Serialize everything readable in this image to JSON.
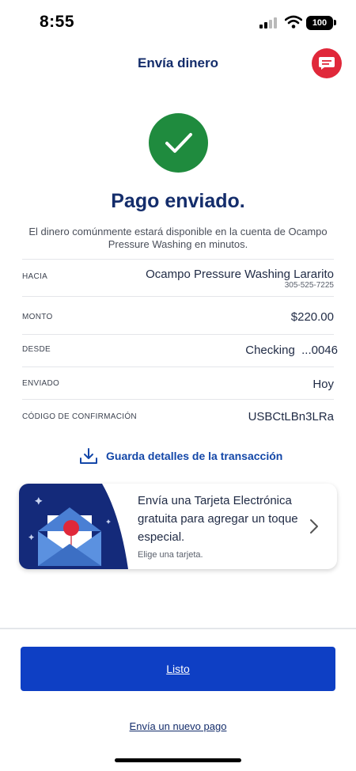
{
  "status_bar": {
    "time": "8:55",
    "battery": "100"
  },
  "header": {
    "title": "Envía dinero"
  },
  "confirmation": {
    "headline": "Pago enviado.",
    "message": "El dinero comúnmente estará disponible en la cuenta de Ocampo Pressure Washing en minutos."
  },
  "details": {
    "to_label": "HACIA",
    "to_value": "Ocampo Pressure Washing Lararito",
    "to_phone": "305-525-7225",
    "amount_label": "MONTO",
    "amount_value": "$220.00",
    "from_label": "DESDE",
    "from_value": "Checking  ...0046",
    "sent_label": "ENVIADO",
    "sent_value": "Hoy",
    "code_label": "CÓDIGO DE CONFIRMACIÓN",
    "code_value": "USBCtLBn3LRa"
  },
  "save_details": {
    "label": "Guarda detalles de la transacción",
    "icon": "download-icon"
  },
  "ecard": {
    "title": "Envía una Tarjeta Electrónica gratuita para agregar un toque especial.",
    "subtitle": "Elige una tarjeta."
  },
  "actions": {
    "done_label": "Listo",
    "new_payment_label": "Envía un nuevo pago"
  },
  "colors": {
    "brand_navy": "#142d6b",
    "primary_blue": "#0e3fc4",
    "success_green": "#1f8b3e",
    "chat_red": "#e0283a"
  }
}
